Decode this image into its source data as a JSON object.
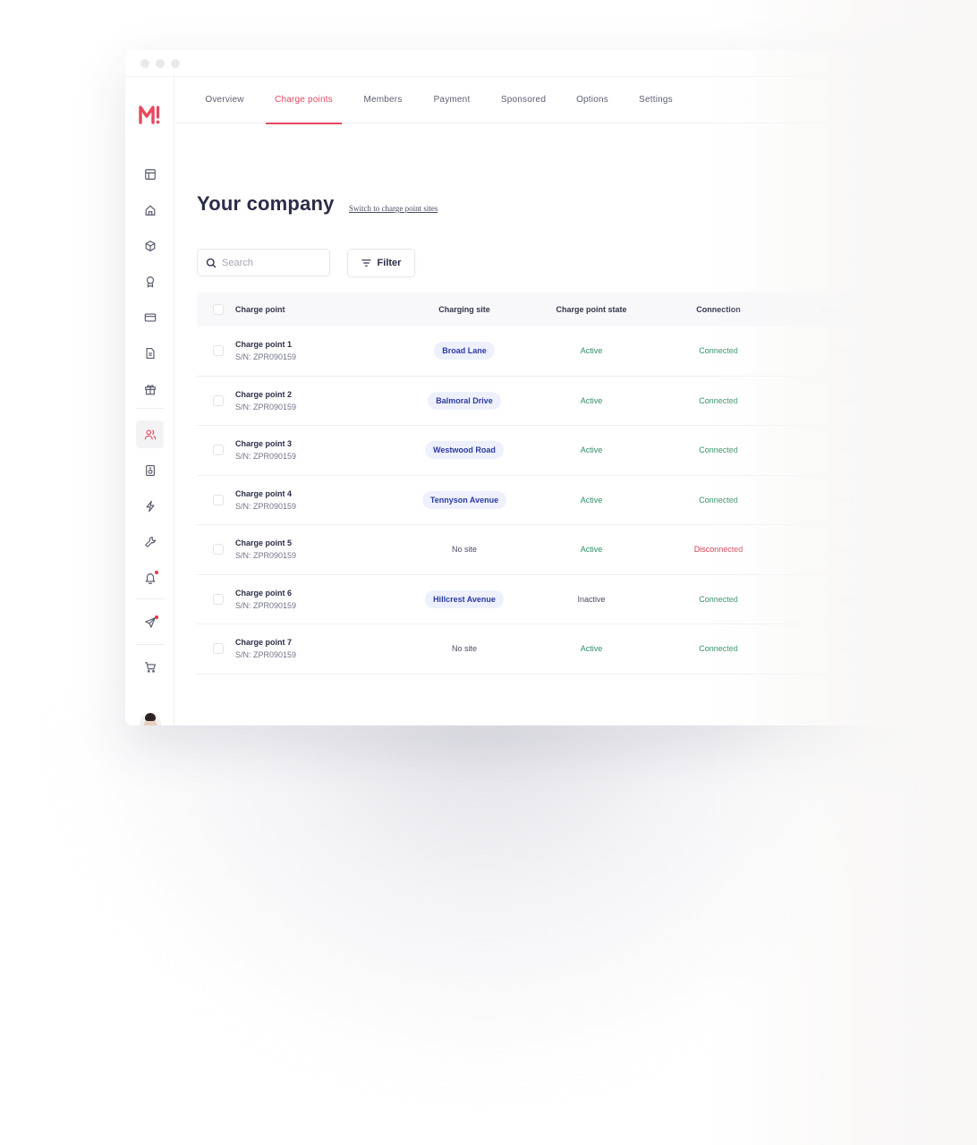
{
  "app": {
    "logo_text": "M!",
    "brand_color": "#e8485e"
  },
  "topnav": {
    "tabs": [
      {
        "label": "Overview",
        "active": false
      },
      {
        "label": "Charge points",
        "active": true
      },
      {
        "label": "Members",
        "active": false
      },
      {
        "label": "Payment",
        "active": false
      },
      {
        "label": "Sponsored",
        "active": false
      },
      {
        "label": "Options",
        "active": false
      },
      {
        "label": "Settings",
        "active": false
      }
    ]
  },
  "sidebar": {
    "items": [
      {
        "icon": "layout-icon"
      },
      {
        "icon": "home-icon"
      },
      {
        "icon": "cube-icon"
      },
      {
        "icon": "award-icon"
      },
      {
        "icon": "credit-card-icon"
      },
      {
        "icon": "document-icon"
      },
      {
        "icon": "gift-icon"
      },
      {
        "icon": "users-icon",
        "active": true
      },
      {
        "icon": "speaker-icon"
      },
      {
        "icon": "lightning-icon"
      },
      {
        "icon": "wrench-icon"
      },
      {
        "icon": "bell-icon",
        "badge": true
      },
      {
        "icon": "send-icon",
        "badge": true
      },
      {
        "icon": "cart-icon"
      }
    ],
    "avatar": "user-avatar"
  },
  "page": {
    "title": "Your company",
    "switch_link": "Switch to charge point sites",
    "search_placeholder": "Search",
    "filter_label": "Filter"
  },
  "table": {
    "headers": {
      "charge_point": "Charge point",
      "charging_site": "Charging site",
      "state": "Charge point state",
      "connection": "Connection",
      "accessibility": "Accessibility"
    },
    "rows": [
      {
        "name": "Charge point 1",
        "sn": "S/N: ZPR090159",
        "site": "Broad Lane",
        "has_site": true,
        "state": "Active",
        "connection": "Connected",
        "accessibility": "Public"
      },
      {
        "name": "Charge point 2",
        "sn": "S/N: ZPR090159",
        "site": "Balmoral Drive",
        "has_site": true,
        "state": "Active",
        "connection": "Connected",
        "accessibility": "Public"
      },
      {
        "name": "Charge point 3",
        "sn": "S/N: ZPR090159",
        "site": "Westwood Road",
        "has_site": true,
        "state": "Active",
        "connection": "Connected",
        "accessibility": "Public"
      },
      {
        "name": "Charge point 4",
        "sn": "S/N: ZPR090159",
        "site": "Tennyson Avenue",
        "has_site": true,
        "state": "Active",
        "connection": "Connected",
        "accessibility": "Public"
      },
      {
        "name": "Charge point 5",
        "sn": "S/N: ZPR090159",
        "site": "No site",
        "has_site": false,
        "state": "Active",
        "connection": "Disconnected",
        "accessibility": "Public"
      },
      {
        "name": "Charge point 6",
        "sn": "S/N: ZPR090159",
        "site": "Hillcrest Avenue",
        "has_site": true,
        "state": "Inactive",
        "connection": "Connected",
        "accessibility": "Public"
      },
      {
        "name": "Charge point 7",
        "sn": "S/N: ZPR090159",
        "site": "No site",
        "has_site": false,
        "state": "Active",
        "connection": "Connected",
        "accessibility": "Public"
      }
    ]
  },
  "colors": {
    "active_green": "#2f8e64",
    "disconnected_red": "#d03a4c",
    "site_pill_bg": "#eef1fd",
    "site_pill_text": "#2b3aa0"
  }
}
